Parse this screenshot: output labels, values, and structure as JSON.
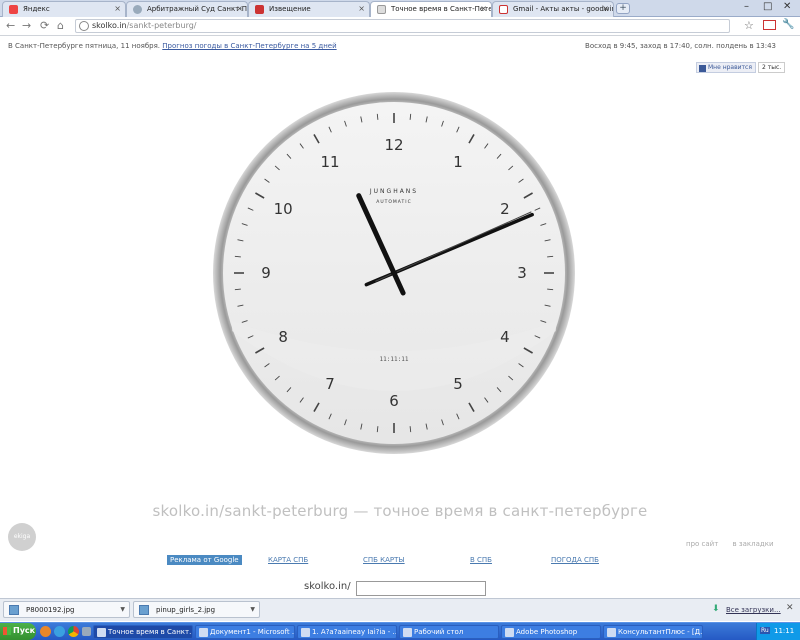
{
  "tabs": [
    {
      "label": "Яндекс",
      "icon": "yandex-icon",
      "active": false
    },
    {
      "label": "Арбитражный Суд Санкт-Пе",
      "icon": "court-icon",
      "active": false
    },
    {
      "label": "Извещение",
      "icon": "doc-icon",
      "active": false
    },
    {
      "label": "Точное время в Санкт-Петер",
      "icon": "page-icon",
      "active": true
    },
    {
      "label": "Gmail - Акты акты - goodwin",
      "icon": "gmail-icon",
      "active": false
    }
  ],
  "toolbar": {
    "url_host": "skolko.in",
    "url_path": "/sankt-peterburg/"
  },
  "infobar": {
    "left_text": "В Санкт-Петербурге пятница, 11 ноября.",
    "left_link": "Прогноз погоды в Санкт-Петербурге на 5 дней",
    "right_text": "Восход в 9:45, заход в 17:40, солн. полдень в 13:43"
  },
  "social": {
    "like_label": "Мне нравится",
    "like_count": "2 тыс."
  },
  "clock": {
    "brand": "JUNGHANS",
    "model": "AUTOMATIC",
    "digital": "11:11:11",
    "numerals": [
      "12",
      "1",
      "2",
      "3",
      "4",
      "5",
      "6",
      "7",
      "8",
      "9",
      "10",
      "11"
    ],
    "hour": 11,
    "minute": 11,
    "second": 11
  },
  "slogan": "skolko.in/sankt-peterburg — точное время в санкт-петербурге",
  "corner_logo": "ekiga",
  "small_links": {
    "about": "про сайт",
    "bookmarks": "в закладки"
  },
  "nav": {
    "ad": "Реклама от Google",
    "links": [
      "КАРТА СПБ",
      "СПБ КАРТЫ",
      "В СПБ",
      "ПОГОДА СПБ"
    ]
  },
  "url_form": {
    "label": "skolko.in/",
    "value": ""
  },
  "downloads": {
    "items": [
      {
        "name": "P8000192.jpg"
      },
      {
        "name": "pinup_girls_2.jpg"
      }
    ],
    "all_label": "Все загрузки..."
  },
  "taskbar": {
    "start_label": "Пуск",
    "buttons": [
      {
        "label": "Точное время в Санкт...",
        "active": true
      },
      {
        "label": "Документ1 - Microsoft ...",
        "active": false
      },
      {
        "label": "1. А?а?ааineay Iai?ia - ...",
        "active": false
      },
      {
        "label": "Рабочий стол",
        "active": false
      },
      {
        "label": "Adobe Photoshop",
        "active": false
      },
      {
        "label": "КонсультантПлюс - [Д...",
        "active": false
      }
    ],
    "lang": "Ru",
    "time": "11:11"
  }
}
